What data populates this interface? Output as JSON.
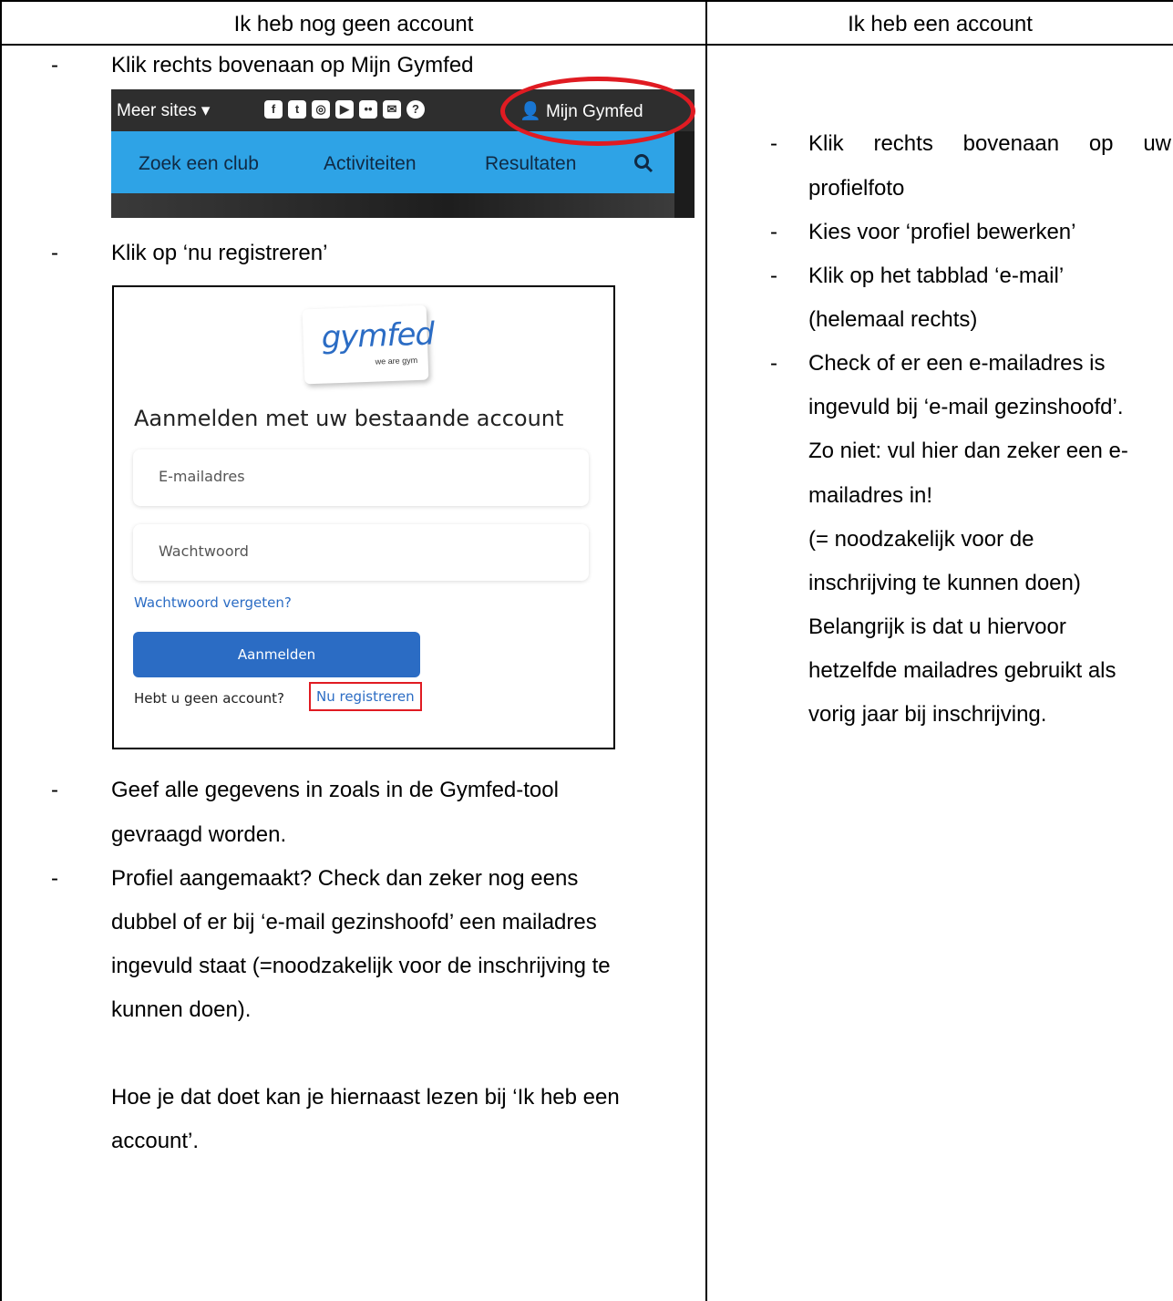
{
  "table": {
    "header_left": "Ik heb nog geen account",
    "header_right": "Ik heb een account"
  },
  "left": {
    "bullet_marker": "-",
    "step1": "Klik rechts bovenaan op Mijn Gymfed",
    "step2": "Klik op ‘nu registreren’",
    "step3_line1": "Geef alle gegevens in zoals in de Gymfed-tool",
    "step3_line2": "gevraagd worden.",
    "step4_line1": "Profiel aangemaakt? Check dan zeker nog eens",
    "step4_line2": "dubbel of er bij ‘e-mail gezinshoofd’ een mailadres",
    "step4_line3": "ingevuld staat (=noodzakelijk voor de inschrijving te",
    "step4_line4": "kunnen doen).",
    "note_line1": "Hoe je dat doet kan je hiernaast lezen bij ‘Ik heb een",
    "note_line2": "account’."
  },
  "nav_screenshot": {
    "more_sites": "Meer sites ▾",
    "my_account": "Mijn Gymfed",
    "items": [
      "Zoek een club",
      "Activiteiten",
      "Resultaten"
    ],
    "social_icons": [
      "facebook-icon",
      "twitter-icon",
      "instagram-icon",
      "youtube-icon",
      "flickr-icon",
      "mail-icon",
      "help-icon"
    ],
    "accent_color": "#2ea3e6",
    "highlight_color": "#e01b22"
  },
  "login_screenshot": {
    "logo_text": "gymfed",
    "logo_tagline": "we are gym",
    "title": "Aanmelden met uw bestaande account",
    "email_placeholder": "E-mailadres",
    "password_placeholder": "Wachtwoord",
    "forgot_link": "Wachtwoord vergeten?",
    "login_button": "Aanmelden",
    "no_account_text": "Hebt u geen account?",
    "register_link": "Nu registreren",
    "button_color": "#2b6cc4"
  },
  "right": {
    "bullet_marker": "-",
    "step1_line1": "Klik rechts bovenaan op uw",
    "step1_line2": "profielfoto",
    "step2": "Kies voor ‘profiel bewerken’",
    "step3_line1": "Klik op het tabblad ‘e-mail’",
    "step3_line2": "(helemaal rechts)",
    "step4_line1": "Check of er een e-mailadres is",
    "step4_line2": "ingevuld bij ‘e-mail gezinshoofd’.",
    "step4_line3": "Zo niet: vul hier dan zeker een e-",
    "step4_line4": "mailadres in!",
    "step4_line5": "(= noodzakelijk voor de",
    "step4_line6": "inschrijving te kunnen doen)",
    "step4_line7": "Belangrijk is dat u hiervoor",
    "step4_line8": "hetzelfde mailadres gebruikt als",
    "step4_line9": "vorig jaar bij inschrijving."
  }
}
